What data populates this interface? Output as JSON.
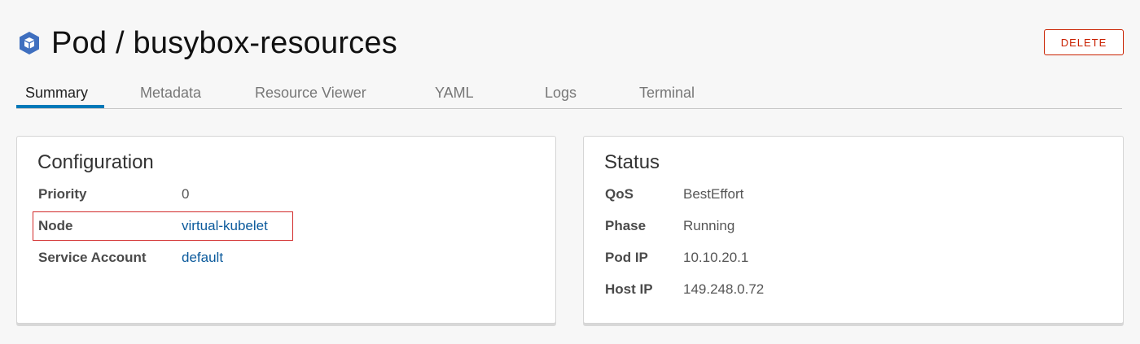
{
  "header": {
    "title": "Pod / busybox-resources",
    "icon": "kubernetes-pod-icon",
    "delete_label": "DELETE"
  },
  "tabs": [
    {
      "label": "Summary",
      "active": true
    },
    {
      "label": "Metadata",
      "active": false
    },
    {
      "label": "Resource Viewer",
      "active": false
    },
    {
      "label": "YAML",
      "active": false
    },
    {
      "label": "Logs",
      "active": false
    },
    {
      "label": "Terminal",
      "active": false
    }
  ],
  "configuration": {
    "title": "Configuration",
    "rows": [
      {
        "label": "Priority",
        "value": "0"
      },
      {
        "label": "Node",
        "value": "virtual-kubelet"
      },
      {
        "label": "Service Account",
        "value": "default"
      }
    ]
  },
  "status": {
    "title": "Status",
    "rows": [
      {
        "label": "QoS",
        "value": "BestEffort"
      },
      {
        "label": "Phase",
        "value": "Running"
      },
      {
        "label": "Pod IP",
        "value": "10.10.20.1"
      },
      {
        "label": "Host IP",
        "value": "149.248.0.72"
      }
    ]
  },
  "colors": {
    "accent": "#0079b8",
    "link": "#0b5a9c",
    "danger": "#c92100",
    "highlight": "#d22a2a",
    "icon_blue": "#3f6fbf"
  }
}
